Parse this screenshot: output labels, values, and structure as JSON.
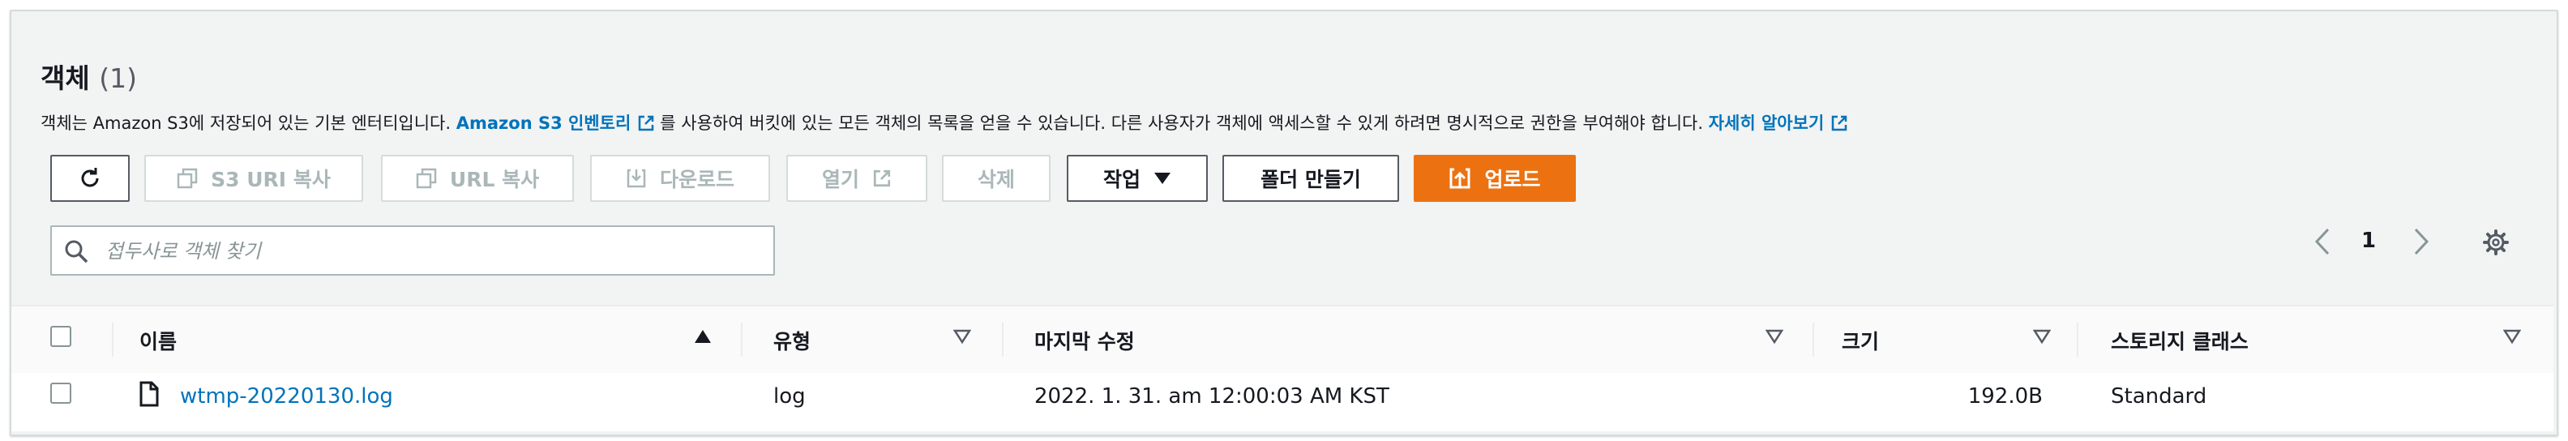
{
  "header": {
    "title": "객체",
    "count": "(1)"
  },
  "description": {
    "text1": "객체는 Amazon S3에 저장되어 있는 기본 엔터티입니다.",
    "link1": "Amazon S3 인벤토리",
    "text2": "를 사용하여 버킷에 있는 모든 객체의 목록을 얻을 수 있습니다. 다른 사용자가 객체에 액세스할 수 있게 하려면 명시적으로 권한을 부여해야 합니다.",
    "link2": "자세히 알아보기"
  },
  "toolbar": {
    "copy_s3_uri": "S3 URI 복사",
    "copy_url": "URL 복사",
    "download": "다운로드",
    "open": "열기",
    "delete": "삭제",
    "actions": "작업",
    "create_folder": "폴더 만들기",
    "upload": "업로드"
  },
  "search": {
    "placeholder": "접두사로 객체 찾기",
    "value": ""
  },
  "pagination": {
    "current_page": "1"
  },
  "table": {
    "columns": [
      "이름",
      "유형",
      "마지막 수정",
      "크기",
      "스토리지 클래스"
    ],
    "rows": [
      {
        "name": "wtmp-20220130.log",
        "type": "log",
        "last_modified": "2022. 1. 31. am 12:00:03 AM KST",
        "size": "192.0B",
        "storage_class": "Standard"
      }
    ]
  },
  "icons": {
    "refresh": "refresh-icon",
    "copy": "copy-icon",
    "download": "download-icon",
    "external": "external-link-icon",
    "caret": "caret-down-icon",
    "upload": "upload-icon",
    "search": "search-icon",
    "prev": "chevron-left-icon",
    "next": "chevron-right-icon",
    "settings": "gear-icon",
    "file": "file-icon"
  },
  "colors": {
    "link": "#0073bb",
    "primary": "#ec7211",
    "disabled": "#aab7b8",
    "panel_bg": "#f2f3f3"
  }
}
